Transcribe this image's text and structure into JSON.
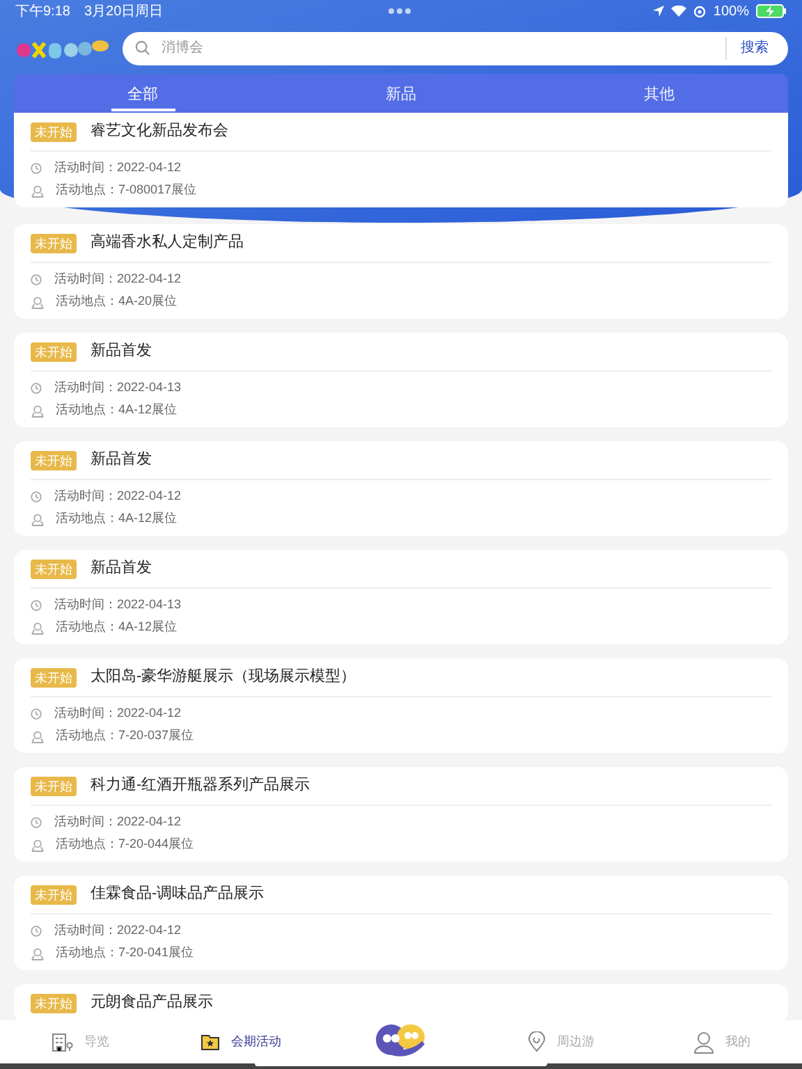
{
  "status_bar": {
    "time": "下午9:18",
    "date": "3月20日周日",
    "battery": "100%"
  },
  "search": {
    "placeholder": "消博会",
    "button": "搜索"
  },
  "tabs": [
    {
      "label": "全部",
      "selected": true
    },
    {
      "label": "新品",
      "selected": false
    },
    {
      "label": "其他",
      "selected": false
    }
  ],
  "events": [
    {
      "badge": "未开始",
      "title": "睿艺文化新品发布会",
      "time": "活动时间：2022-04-12",
      "location": "活动地点：7-080017展位"
    },
    {
      "badge": "未开始",
      "title": "高端香水私人定制产品",
      "time": "活动时间：2022-04-12",
      "location": "活动地点：4A-20展位"
    },
    {
      "badge": "未开始",
      "title": "新品首发",
      "time": "活动时间：2022-04-13",
      "location": "活动地点：4A-12展位"
    },
    {
      "badge": "未开始",
      "title": "新品首发",
      "time": "活动时间：2022-04-12",
      "location": "活动地点：4A-12展位"
    },
    {
      "badge": "未开始",
      "title": "新品首发",
      "time": "活动时间：2022-04-13",
      "location": "活动地点：4A-12展位"
    },
    {
      "badge": "未开始",
      "title": "太阳岛-豪华游艇展示（现场展示模型）",
      "time": "活动时间：2022-04-12",
      "location": "活动地点：7-20-037展位"
    },
    {
      "badge": "未开始",
      "title": "科力通-红酒开瓶器系列产品展示",
      "time": "活动时间：2022-04-12",
      "location": "活动地点：7-20-044展位"
    },
    {
      "badge": "未开始",
      "title": "佳霖食品-调味品产品展示",
      "time": "活动时间：2022-04-12",
      "location": "活动地点：7-20-041展位"
    },
    {
      "badge": "未开始",
      "title": "元朗食品产品展示"
    }
  ],
  "bottom_nav": [
    {
      "kind": "guide",
      "label": "导览",
      "selected": false
    },
    {
      "kind": "events",
      "label": "会期活动",
      "selected": true
    },
    {
      "kind": "mascot"
    },
    {
      "kind": "nearby",
      "label": "周边游",
      "selected": false
    },
    {
      "kind": "profile",
      "label": "我的",
      "selected": false
    }
  ]
}
